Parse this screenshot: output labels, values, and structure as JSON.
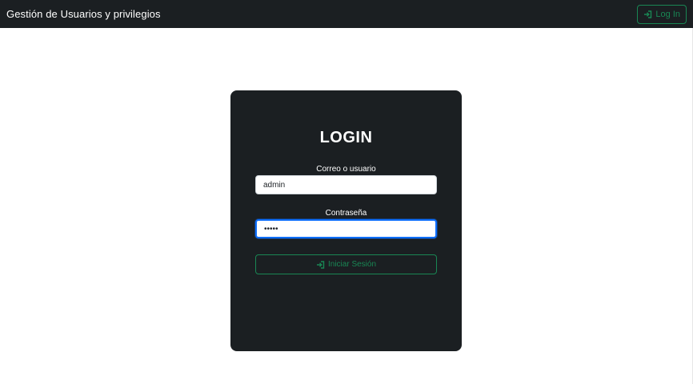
{
  "navbar": {
    "brand": "Gestión de Usuarios y privilegios",
    "login_button": {
      "label": "Log In",
      "icon": "sign-in-icon"
    }
  },
  "login_card": {
    "title": "LOGIN",
    "username": {
      "label": "Correo o usuario",
      "value": "admin"
    },
    "password": {
      "label": "Contraseña",
      "value": "•••••"
    },
    "submit": {
      "label": "Iniciar Sesión",
      "icon": "sign-in-icon"
    }
  },
  "colors": {
    "dark": "#1b1f22",
    "success": "#198754",
    "focus": "#0d6efd"
  }
}
